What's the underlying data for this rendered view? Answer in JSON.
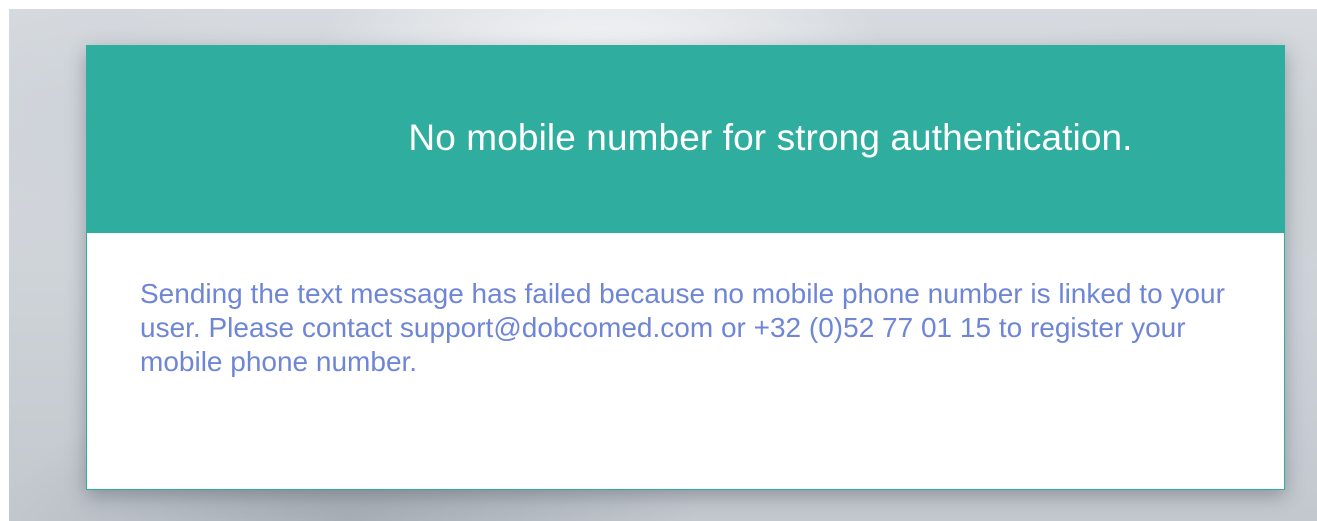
{
  "dialog": {
    "title": "No mobile number for strong authentication.",
    "message": "Sending the text message has failed because no mobile phone number is linked to your user. Please contact support@dobcomed.com or +32 (0)52 77 01 15 to register your mobile phone number."
  },
  "colors": {
    "header_accent": "#2fae9f",
    "message_text": "#6f86d6",
    "title_text": "#ffffff"
  }
}
